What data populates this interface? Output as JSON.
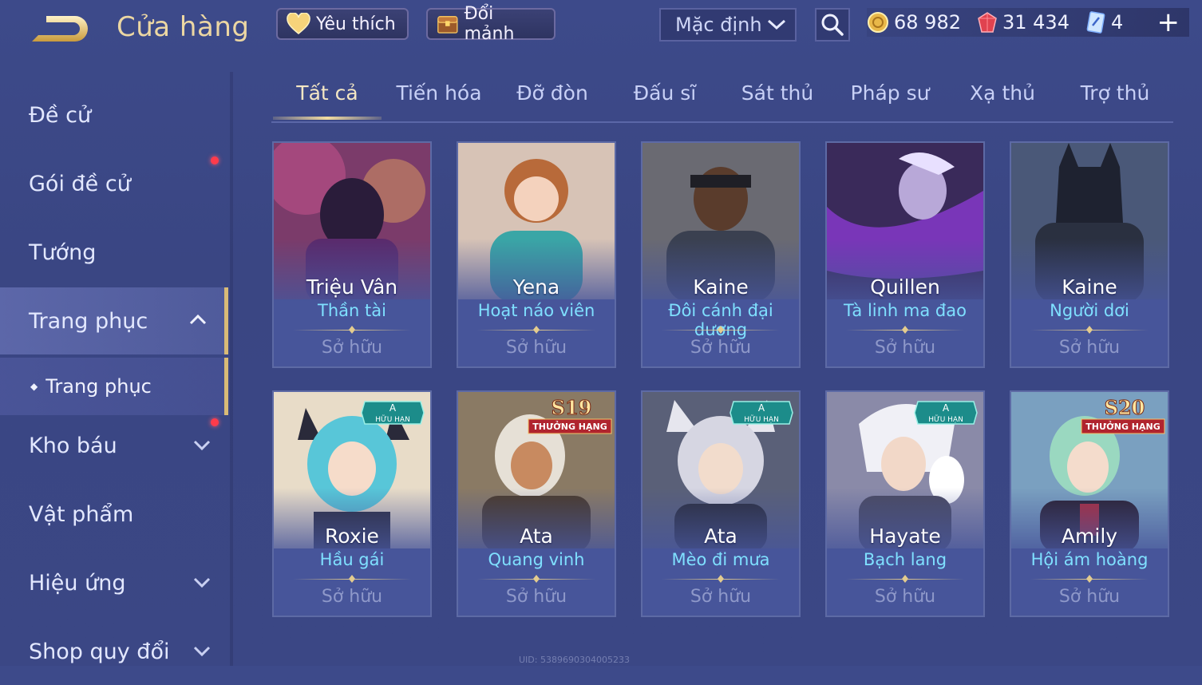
{
  "header": {
    "title": "Cửa hàng",
    "favorites_label": "Yêu thích",
    "exchange_label": "Đổi mảnh",
    "sort_label": "Mặc định"
  },
  "wallet": {
    "gold": "68 982",
    "vouchers": "31 434",
    "tickets": "4"
  },
  "sidebar": {
    "items": [
      {
        "label": "Đề cử"
      },
      {
        "label": "Gói đề cử"
      },
      {
        "label": "Tướng"
      },
      {
        "label": "Trang phục"
      },
      {
        "label": "Trang phục"
      },
      {
        "label": "Kho báu"
      },
      {
        "label": "Vật phẩm"
      },
      {
        "label": "Hiệu ứng"
      },
      {
        "label": "Shop quy đổi"
      }
    ]
  },
  "tabs": [
    "Tất cả",
    "Tiến hóa",
    "Đỡ đòn",
    "Đấu sĩ",
    "Sát thủ",
    "Pháp sư",
    "Xạ thủ",
    "Trợ thủ"
  ],
  "cards": [
    {
      "hero": "Triệu Vân",
      "skin": "Thần tài",
      "status": "Sở hữu"
    },
    {
      "hero": "Yena",
      "skin": "Hoạt náo viên",
      "status": "Sở hữu"
    },
    {
      "hero": "Kaine",
      "skin": "Đôi cánh đại dương",
      "status": "Sở hữu"
    },
    {
      "hero": "Quillen",
      "skin": "Tà linh ma đao",
      "status": "Sở hữu"
    },
    {
      "hero": "Kaine",
      "skin": "Người dơi",
      "status": "Sở hữu"
    },
    {
      "hero": "Roxie",
      "skin": "Hầu gái",
      "status": "Sở hữu",
      "badge": "A",
      "badge_sub": "HỮU HẠN"
    },
    {
      "hero": "Ata",
      "skin": "Quang vinh",
      "status": "Sở hữu",
      "badge": "S19",
      "badge_sub": "THƯỞNG HẠNG"
    },
    {
      "hero": "Ata",
      "skin": "Mèo đi mưa",
      "status": "Sở hữu",
      "badge": "A",
      "badge_sub": "HỮU HẠN"
    },
    {
      "hero": "Hayate",
      "skin": "Bạch lang",
      "status": "Sở hữu",
      "badge": "A",
      "badge_sub": "HỮU HẠN"
    },
    {
      "hero": "Amily",
      "skin": "Hội ám hoàng",
      "status": "Sở hữu",
      "badge": "S20",
      "badge_sub": "THƯỞNG HẠNG"
    }
  ],
  "footer": {
    "uid": "UID: 5389690304005233"
  },
  "colors": {
    "accent_gold": "#e4cc8e",
    "skin_name": "#7fe0ff",
    "notify_red": "#ff3b4b"
  }
}
